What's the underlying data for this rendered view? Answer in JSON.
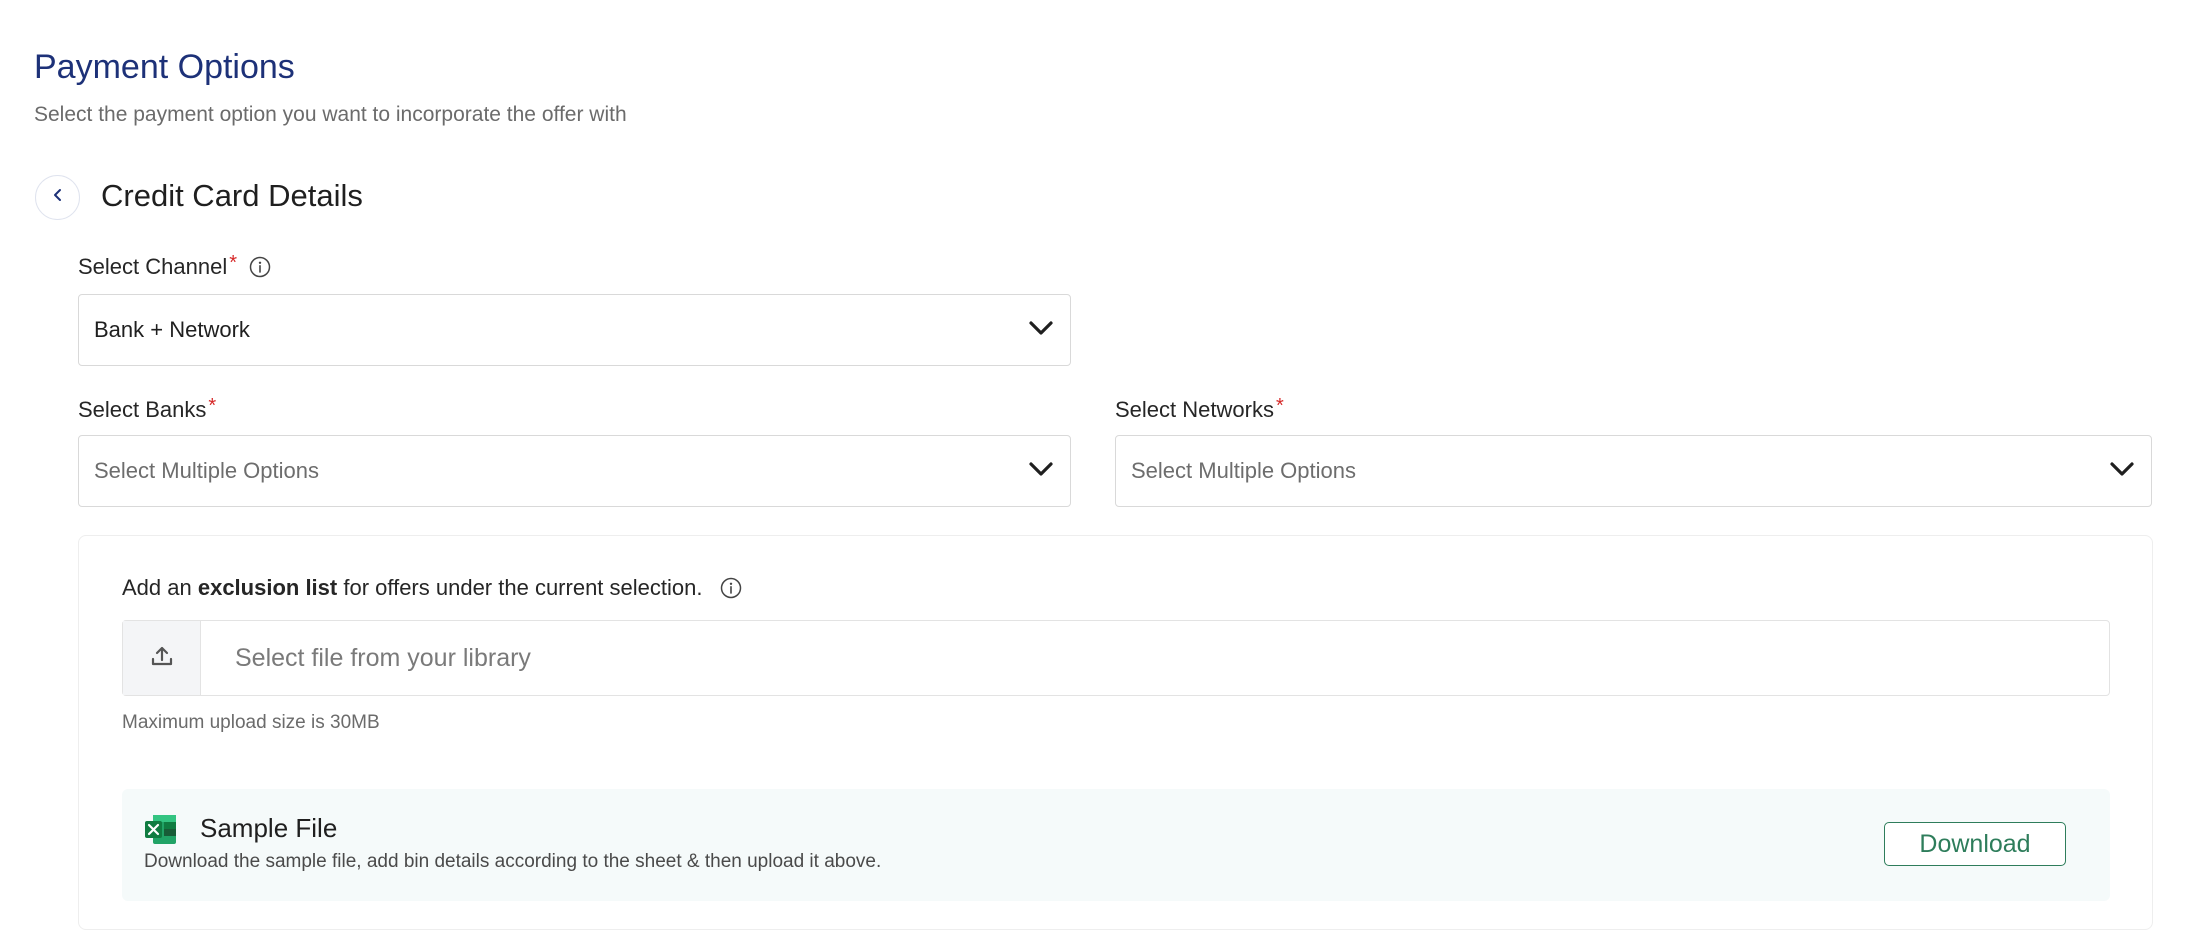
{
  "header": {
    "title": "Payment Options",
    "subtitle": "Select the payment option you want to incorporate the offer with"
  },
  "section": {
    "title": "Credit Card Details"
  },
  "channel": {
    "label": "Select Channel",
    "required_mark": "*",
    "value": "Bank + Network"
  },
  "banks": {
    "label": "Select Banks",
    "required_mark": "*",
    "placeholder": "Select Multiple Options"
  },
  "networks": {
    "label": "Select Networks",
    "required_mark": "*",
    "placeholder": "Select Multiple Options"
  },
  "exclusion": {
    "text_before": "Add an ",
    "text_bold": "exclusion list",
    "text_after": " for offers under the current selection.",
    "upload_placeholder": "Select file from your library",
    "upload_hint": "Maximum upload size is 30MB"
  },
  "sample_file": {
    "title": "Sample File",
    "description": "Download the sample file, add bin details according to the sheet & then upload it above.",
    "download_label": "Download"
  },
  "icons": {
    "back": "chevron-left-icon",
    "info": "info-icon",
    "dropdown": "chevron-down-icon",
    "upload": "upload-icon",
    "excel": "excel-file-icon"
  },
  "colors": {
    "title": "#1d3178",
    "required": "#d62828",
    "download_accent": "#2e7d5b",
    "sample_bg": "#f5fafa"
  }
}
